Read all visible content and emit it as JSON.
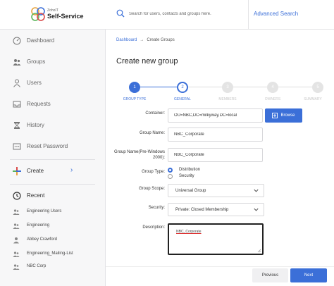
{
  "app": {
    "brand_small": "ZohoIT",
    "title": "Self-Service"
  },
  "search": {
    "placeholder": "Search for users, contacts and groups here.",
    "advanced_label": "Advanced Search"
  },
  "sidebar": {
    "items": [
      {
        "label": "Dashboard",
        "icon": "dashboard-icon"
      },
      {
        "label": "Groups",
        "icon": "groups-icon"
      },
      {
        "label": "Users",
        "icon": "user-icon"
      },
      {
        "label": "Requests",
        "icon": "inbox-icon"
      },
      {
        "label": "History",
        "icon": "history-icon"
      },
      {
        "label": "Reset Password",
        "icon": "keypad-icon"
      }
    ],
    "create_label": "Create",
    "recent_label": "Recent",
    "recent": [
      {
        "label": "Engineering Users",
        "icon": "group-icon"
      },
      {
        "label": "Engineering",
        "icon": "group-icon"
      },
      {
        "label": "Abbey Crawford",
        "icon": "user-icon"
      },
      {
        "label": "Engineering_Mailing-List",
        "icon": "group-icon"
      },
      {
        "label": "NBC Corp",
        "icon": "group-icon"
      }
    ]
  },
  "breadcrumb": {
    "root": "Dashboard",
    "current": "Create Groups"
  },
  "page_title": "Create new group",
  "steps": [
    {
      "number": "1",
      "label": "GROUP TYPE"
    },
    {
      "number": "2",
      "label": "GENERAL"
    },
    {
      "number": "3",
      "label": "MEMBERS"
    },
    {
      "number": "4",
      "label": "OWNERS"
    },
    {
      "number": "5",
      "label": "SUMMARY"
    }
  ],
  "form": {
    "container_label": "Container:",
    "container_value": "OU=NBC,DC=milkyway,DC=local",
    "browse_label": "Browse",
    "group_name_label": "Group Name:",
    "group_name_value": "NBC_Corporate",
    "pre2000_label": "Group Name(Pre-Windows 2000):",
    "pre2000_value": "NBC_Corporate",
    "group_type_label": "Group Type:",
    "group_type_options": [
      "Distribution",
      "Security"
    ],
    "group_type_selected": "Distribution",
    "group_scope_label": "Group Scope:",
    "group_scope_value": "Universal Group",
    "security_label": "Security:",
    "security_value": "Private: Closed Membership",
    "description_label": "Description:",
    "description_value": "NBC_Corporate"
  },
  "buttons": {
    "previous": "Previous",
    "next": "Next"
  },
  "colors": {
    "accent": "#3b6fd8",
    "sidebar_bg": "#f7f7f8"
  }
}
